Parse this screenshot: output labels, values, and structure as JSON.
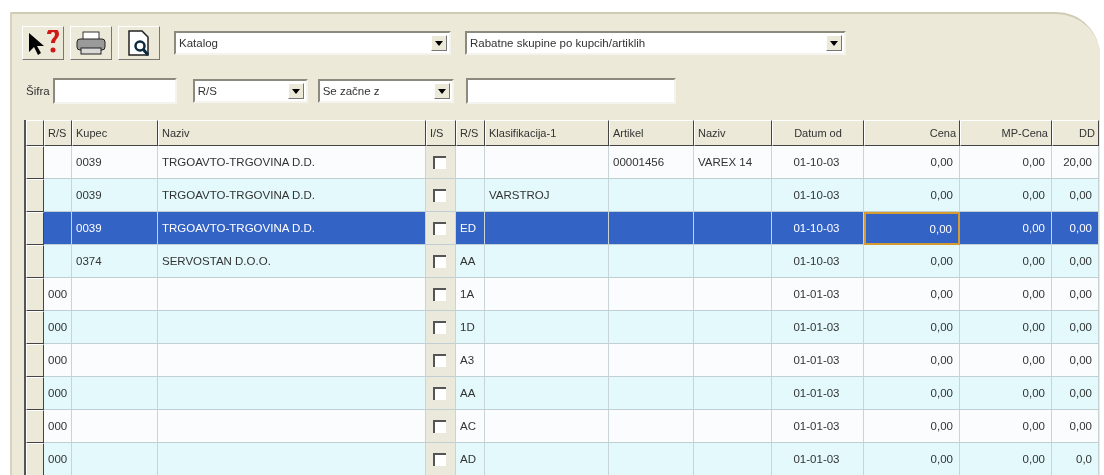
{
  "toolbar": {
    "buttons": [
      {
        "kind": "help"
      },
      {
        "kind": "print"
      },
      {
        "kind": "preview"
      }
    ],
    "dropdowns": [
      {
        "value": "Katalog"
      },
      {
        "value": "Rabatne skupine po kupcih/artiklih"
      }
    ]
  },
  "filter": {
    "label": "Šifra",
    "field_dropdown": "R/S",
    "operator_dropdown": "Se začne z"
  },
  "table": {
    "columns": [
      "R/S",
      "Kupec",
      "Naziv",
      "I/S",
      "R/S",
      "Klasifikacija-1",
      "Artikel",
      "Naziv",
      "Datum od",
      "Cena",
      "MP-Cena",
      "DD"
    ],
    "rows": [
      {
        "selected": false,
        "focused": false,
        "checked": false,
        "cells": [
          null,
          "0039",
          "TRGOAVTO-TRGOVINA D.D.",
          null,
          null,
          null,
          "00001456",
          "VAREX 14",
          "01-10-03",
          "0,00",
          "0,00",
          "20,00"
        ]
      },
      {
        "selected": false,
        "focused": false,
        "checked": false,
        "cells": [
          null,
          "0039",
          "TRGOAVTO-TRGOVINA D.D.",
          null,
          null,
          "VARSTROJ",
          null,
          null,
          "01-10-03",
          "0,00",
          "0,00",
          "0,00"
        ]
      },
      {
        "selected": true,
        "focused": true,
        "checked": false,
        "cells": [
          null,
          "0039",
          "TRGOAVTO-TRGOVINA D.D.",
          null,
          "ED",
          null,
          null,
          null,
          "01-10-03",
          "0,00",
          "0,00",
          "0,00"
        ]
      },
      {
        "selected": false,
        "focused": false,
        "checked": false,
        "cells": [
          null,
          "0374",
          "SERVOSTAN D.O.O.",
          null,
          "AA",
          null,
          null,
          null,
          "01-10-03",
          "0,00",
          "0,00",
          "0,00"
        ]
      },
      {
        "selected": false,
        "focused": false,
        "checked": false,
        "cells": [
          "000",
          null,
          null,
          null,
          "1A",
          null,
          null,
          null,
          "01-01-03",
          "0,00",
          "0,00",
          "0,00"
        ]
      },
      {
        "selected": false,
        "focused": false,
        "checked": false,
        "cells": [
          "000",
          null,
          null,
          null,
          "1D",
          null,
          null,
          null,
          "01-01-03",
          "0,00",
          "0,00",
          "0,00"
        ]
      },
      {
        "selected": false,
        "focused": false,
        "checked": false,
        "cells": [
          "000",
          null,
          null,
          null,
          "A3",
          null,
          null,
          null,
          "01-01-03",
          "0,00",
          "0,00",
          "0,00"
        ]
      },
      {
        "selected": false,
        "focused": false,
        "checked": false,
        "cells": [
          "000",
          null,
          null,
          null,
          "AA",
          null,
          null,
          null,
          "01-01-03",
          "0,00",
          "0,00",
          "0,00"
        ]
      },
      {
        "selected": false,
        "focused": false,
        "checked": false,
        "cells": [
          "000",
          null,
          null,
          null,
          "AC",
          null,
          null,
          null,
          "01-01-03",
          "0,00",
          "0,00",
          "0,00"
        ]
      },
      {
        "selected": false,
        "focused": false,
        "checked": false,
        "cells": [
          "000",
          null,
          null,
          null,
          "AD",
          null,
          null,
          null,
          "01-01-03",
          "0,00",
          "0,00",
          "0,0"
        ]
      }
    ]
  }
}
